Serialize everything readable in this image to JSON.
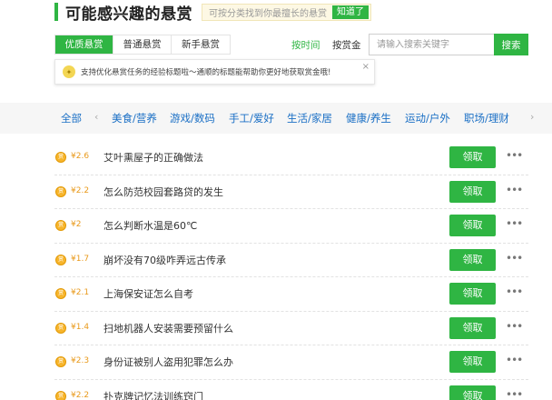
{
  "header": {
    "title": "可能感兴趣的悬赏",
    "hint": "可按分类找到你最擅长的悬赏",
    "hint_button": "知道了"
  },
  "tabs": [
    {
      "label": "优质悬赏",
      "active": true
    },
    {
      "label": "普通悬赏",
      "active": false
    },
    {
      "label": "新手悬赏",
      "active": false
    }
  ],
  "sort": {
    "by_time": "按时间",
    "by_reward": "按赏金"
  },
  "search": {
    "placeholder": "请输入搜索关键字",
    "button": "搜索"
  },
  "tip": {
    "text": "支持优化悬赏任务的经验标题啦～通顺的标题能帮助你更好地获取赏金哦!",
    "close": "×"
  },
  "categories": {
    "all": "全部",
    "prev_arrow": "‹",
    "next_arrow": "›",
    "items": [
      "美食/营养",
      "游戏/数码",
      "手工/爱好",
      "生活/家居",
      "健康/养生",
      "运动/户外",
      "职场/理财"
    ]
  },
  "bounties": [
    {
      "coin": "赏",
      "price": "¥2.6",
      "title": "艾叶熏屋子的正确做法",
      "action": "领取",
      "more": "•••"
    },
    {
      "coin": "赏",
      "price": "¥2.2",
      "title": "怎么防范校园套路贷的发生",
      "action": "领取",
      "more": "•••"
    },
    {
      "coin": "赏",
      "price": "¥2",
      "title": "怎么判断水温是60℃",
      "action": "领取",
      "more": "•••"
    },
    {
      "coin": "赏",
      "price": "¥1.7",
      "title": "崩坏没有70级咋弄远古传承",
      "action": "领取",
      "more": "•••"
    },
    {
      "coin": "赏",
      "price": "¥2.1",
      "title": "上海保安证怎么自考",
      "action": "领取",
      "more": "•••"
    },
    {
      "coin": "赏",
      "price": "¥1.4",
      "title": "扫地机器人安装需要预留什么",
      "action": "领取",
      "more": "•••"
    },
    {
      "coin": "赏",
      "price": "¥2.3",
      "title": "身份证被别人盗用犯罪怎么办",
      "action": "领取",
      "more": "•••"
    },
    {
      "coin": "赏",
      "price": "¥2.2",
      "title": "扑克牌记忆法训练窍门",
      "action": "领取",
      "more": "•••"
    }
  ],
  "colors": {
    "accent": "#2fb543",
    "link": "#1a6fc5",
    "price": "#e99a1c"
  }
}
